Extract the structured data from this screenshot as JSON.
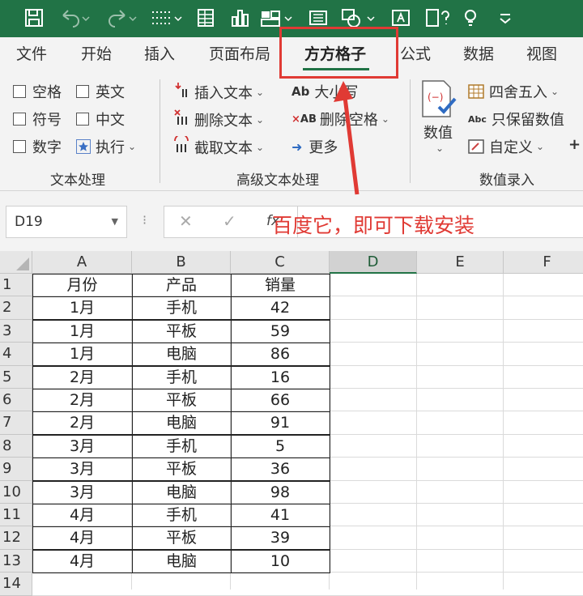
{
  "colors": {
    "excel_green": "#217346",
    "annotation_red": "#e03a34"
  },
  "quick_access_icons": [
    "save-icon",
    "undo-icon",
    "redo-icon",
    "dotted-lines-icon",
    "table-icon",
    "bar-chart-icon",
    "image-grid-icon",
    "scan-icon",
    "shapes-icon",
    "text-box-icon",
    "help-doc-icon",
    "customize-arrow-icon"
  ],
  "tabs": [
    "文件",
    "开始",
    "插入",
    "页面布局",
    "方方格子",
    "公式",
    "数据",
    "视图"
  ],
  "active_tab": "方方格子",
  "ribbon": {
    "text_group": {
      "items": [
        "空格",
        "英文",
        "符号",
        "中文",
        "数字",
        "执行"
      ],
      "label": "文本处理"
    },
    "advanced_group": {
      "items": [
        "插入文本",
        "删除文本",
        "截取文本",
        "大小写",
        "删除空格",
        "更多"
      ],
      "label": "高级文本处理"
    },
    "numeric_group": {
      "big_button": "数值",
      "items": [
        "四舍五入",
        "只保留数值",
        "自定义"
      ],
      "label": "数值录入"
    }
  },
  "formula_bar": {
    "name_box": "D19",
    "fx_symbol": "fx",
    "annotation": "百度它，即可下载安装"
  },
  "sheet": {
    "columns": [
      "A",
      "B",
      "C",
      "D",
      "E",
      "F"
    ],
    "selected_column": "D",
    "row_numbers": [
      "1",
      "2",
      "3",
      "4",
      "5",
      "6",
      "7",
      "8",
      "9",
      "10",
      "11",
      "12",
      "13",
      "14"
    ],
    "headers": [
      "月份",
      "产品",
      "销量"
    ],
    "rows": [
      [
        "1月",
        "手机",
        "42"
      ],
      [
        "1月",
        "平板",
        "59"
      ],
      [
        "1月",
        "电脑",
        "86"
      ],
      [
        "2月",
        "手机",
        "16"
      ],
      [
        "2月",
        "平板",
        "66"
      ],
      [
        "2月",
        "电脑",
        "91"
      ],
      [
        "3月",
        "手机",
        "5"
      ],
      [
        "3月",
        "平板",
        "36"
      ],
      [
        "3月",
        "电脑",
        "98"
      ],
      [
        "4月",
        "手机",
        "41"
      ],
      [
        "4月",
        "平板",
        "39"
      ],
      [
        "4月",
        "电脑",
        "10"
      ]
    ]
  }
}
